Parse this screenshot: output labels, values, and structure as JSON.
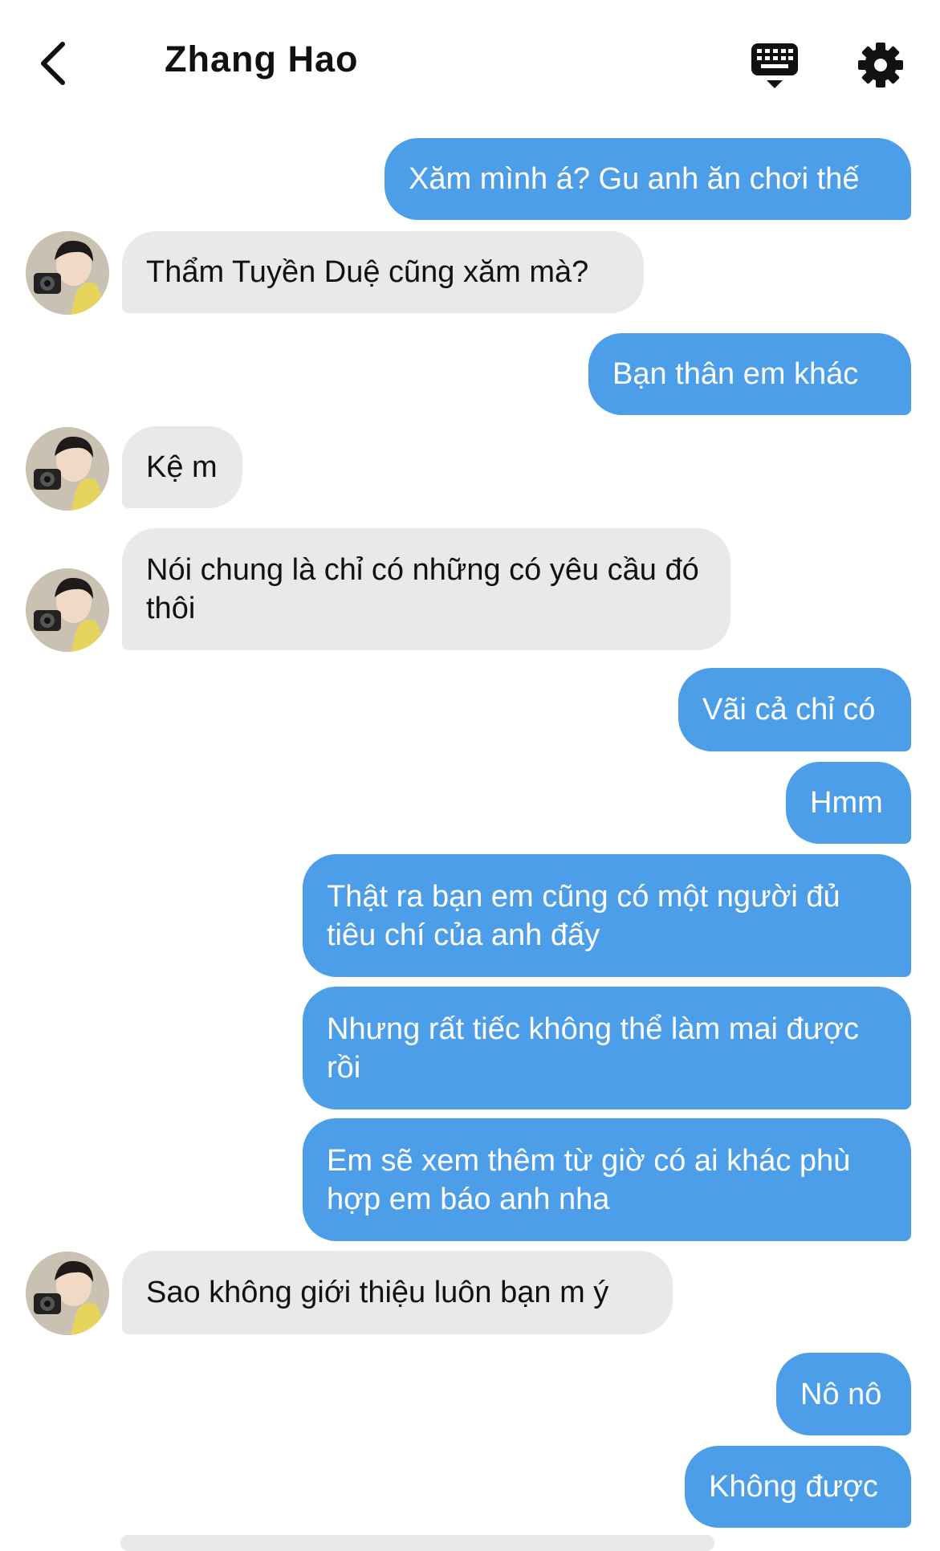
{
  "header": {
    "title": "Zhang Hao",
    "back_icon": "chevron-left-icon",
    "keyboard_icon": "keyboard-icon",
    "settings_icon": "gear-icon"
  },
  "colors": {
    "sent_bubble": "#4d9ee8",
    "received_bubble": "#e9e9eb",
    "background": "#ffffff"
  },
  "messages": [
    {
      "side": "sent",
      "text": "Xăm mình á? Gu anh ăn chơi thế"
    },
    {
      "side": "received",
      "text": "Thẩm Tuyền Duệ cũng xăm mà?"
    },
    {
      "side": "sent",
      "text": "Bạn thân em khác"
    },
    {
      "side": "received",
      "text": "Kệ m"
    },
    {
      "side": "received",
      "text": "Nói chung là chỉ có những có yêu cầu đó thôi"
    },
    {
      "side": "sent",
      "text": "Vãi cả chỉ có"
    },
    {
      "side": "sent",
      "text": "Hmm"
    },
    {
      "side": "sent",
      "text": "Thật ra bạn em cũng có một người đủ tiêu chí của anh đấy"
    },
    {
      "side": "sent",
      "text": "Nhưng rất tiếc không thể làm mai được rồi"
    },
    {
      "side": "sent",
      "text": "Em sẽ xem thêm từ giờ có ai khác phù hợp em báo anh nha"
    },
    {
      "side": "received",
      "text": "Sao không giới thiệu luôn bạn m ý"
    },
    {
      "side": "sent",
      "text": "Nô nô"
    },
    {
      "side": "sent",
      "text": "Không được"
    }
  ]
}
